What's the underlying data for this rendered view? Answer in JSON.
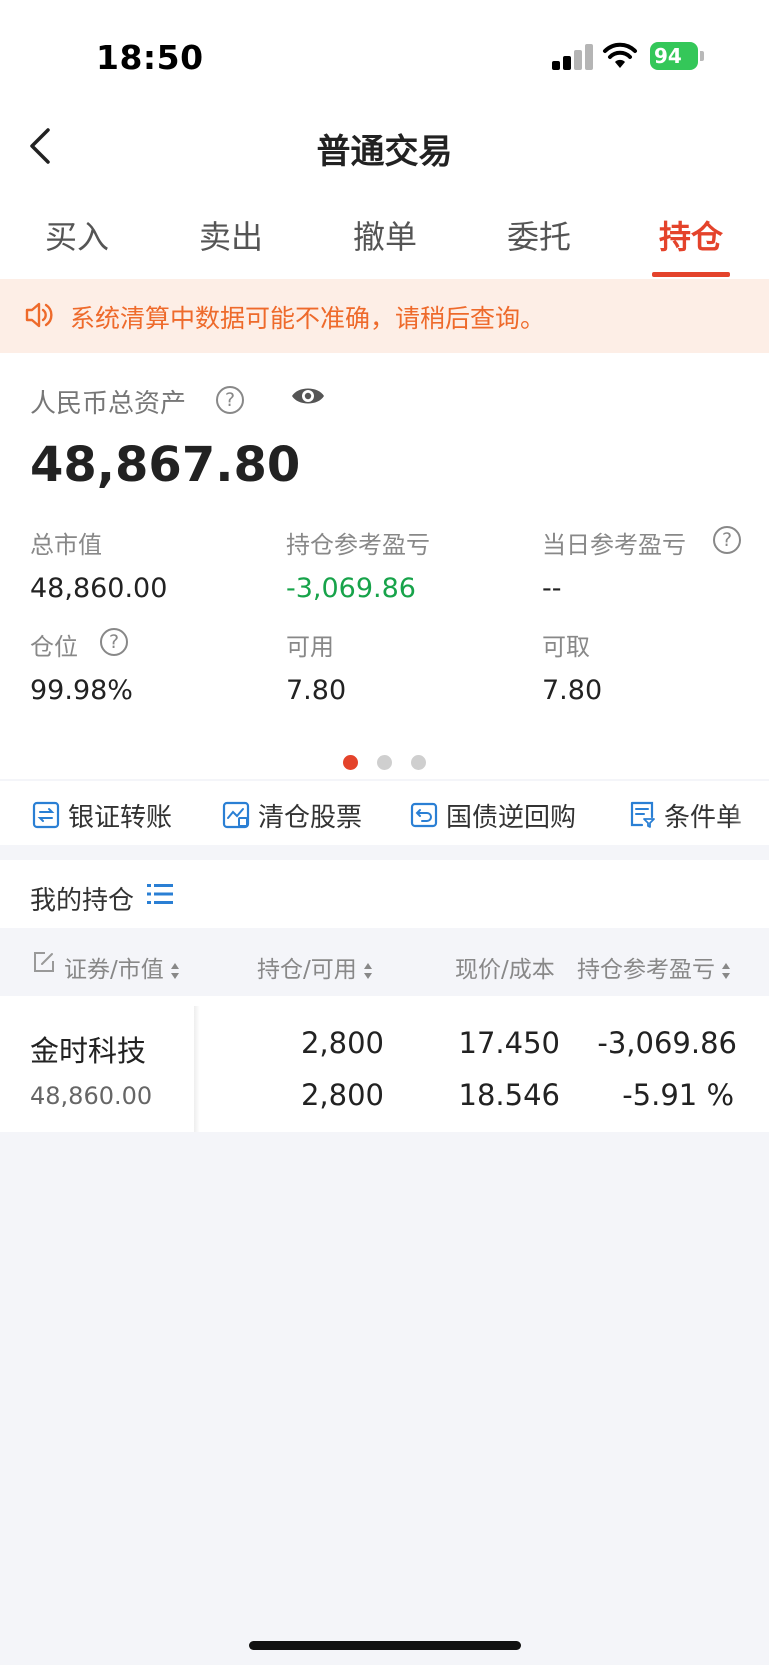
{
  "status_bar": {
    "time": "18:50",
    "battery": "94"
  },
  "nav": {
    "title": "普通交易"
  },
  "tabs": [
    {
      "label": "买入"
    },
    {
      "label": "卖出"
    },
    {
      "label": "撤单"
    },
    {
      "label": "委托"
    },
    {
      "label": "持仓"
    }
  ],
  "active_tab": "持仓",
  "notice": {
    "text": "系统清算中数据可能不准确，请稍后查询。"
  },
  "assets": {
    "label": "人民币总资产",
    "total": "48,867.80",
    "cells": [
      {
        "label": "总市值",
        "value": "48,860.00"
      },
      {
        "label": "持仓参考盈亏",
        "value": "-3,069.86"
      },
      {
        "label": "当日参考盈亏",
        "value": "--"
      },
      {
        "label": "仓位",
        "value": "99.98%"
      },
      {
        "label": "可用",
        "value": "7.80"
      },
      {
        "label": "可取",
        "value": "7.80"
      }
    ],
    "page_dots": {
      "count": 3,
      "active": 1
    }
  },
  "tools": [
    {
      "label": "银证转账",
      "icon": "transfer-icon"
    },
    {
      "label": "清仓股票",
      "icon": "clear-stock-icon"
    },
    {
      "label": "国债逆回购",
      "icon": "reverse-repo-icon"
    },
    {
      "label": "条件单",
      "icon": "condition-order-icon"
    }
  ],
  "holdings": {
    "title": "我的持仓",
    "columns": [
      "证券/市值",
      "持仓/可用",
      "现价/成本",
      "持仓参考盈亏"
    ],
    "rows": [
      {
        "name": "金时科技",
        "market_value": "48,860.00",
        "position": "2,800",
        "available": "2,800",
        "price": "17.450",
        "cost": "18.546",
        "pnl": "-3,069.86",
        "pnl_pct": "-5.91 %"
      }
    ]
  },
  "colors": {
    "accent": "#e4432b",
    "loss": "#17a34a",
    "notice_text": "#ee6a2b",
    "notice_bg": "#fdeee6",
    "tool_icon": "#2a7fd4"
  }
}
